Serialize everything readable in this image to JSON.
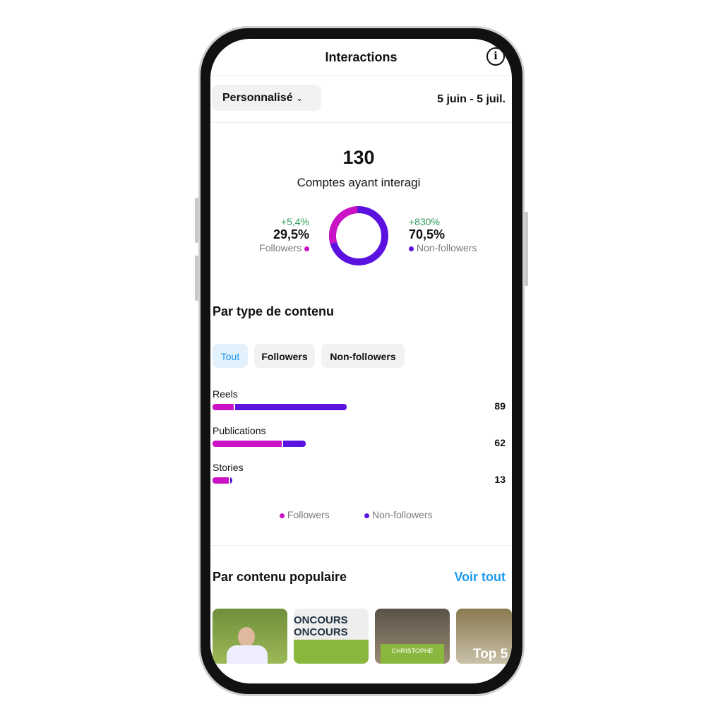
{
  "header": {
    "title": "Interactions",
    "info_icon": "info-icon",
    "back_icon": "chevron-left-icon"
  },
  "filter": {
    "selected": "Personnalisé",
    "date_range": "5 juin - 5 juil."
  },
  "summary": {
    "total": "130",
    "label": "Comptes ayant interagi",
    "followers": {
      "change": "+5,4%",
      "percent": "29,5%",
      "label": "Followers",
      "value": 29.5
    },
    "non_followers": {
      "change": "+830%",
      "percent": "70,5%",
      "label": "Non-followers",
      "value": 70.5
    }
  },
  "colors": {
    "followers": "#c913c4",
    "non_followers": "#5b12e0",
    "accent": "#1a9af0"
  },
  "content_type": {
    "title": "Par type de contenu",
    "tabs": [
      "Tout",
      "Followers",
      "Non-followers"
    ],
    "active_tab": "Tout",
    "chart_data": {
      "type": "bar",
      "orientation": "horizontal",
      "stacked": true,
      "categories": [
        "Reels",
        "Publications",
        "Stories"
      ],
      "totals": [
        "89",
        "62",
        "13"
      ],
      "series": [
        {
          "name": "Followers",
          "values": [
            14,
            46,
            11
          ]
        },
        {
          "name": "Non-followers",
          "values": [
            75,
            16,
            2
          ]
        }
      ]
    },
    "legend": [
      "Followers",
      "Non-followers"
    ]
  },
  "popular": {
    "title": "Par contenu populaire",
    "see_all": "Voir tout",
    "thumbs": [
      "ONCOURS ONCOURS",
      "CHRISTOPHE",
      "Top 5"
    ]
  }
}
